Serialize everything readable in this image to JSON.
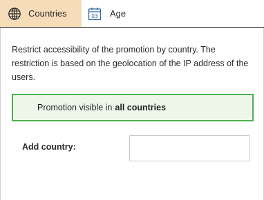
{
  "tabs": {
    "countries": {
      "label": "Countries",
      "icon": "globe-icon",
      "active": true,
      "active_color": "#f6dcb8"
    },
    "age": {
      "label": "Age",
      "icon": "calendar-icon",
      "icon_text": "03",
      "active": false
    }
  },
  "panel": {
    "description": "Restrict accessibility of the promotion by country. The restriction is based on the geolocation of the IP address of the users.",
    "notice": {
      "prefix": "Promotion visible in",
      "emphasis": "all countries",
      "border_color": "#4cb04c",
      "background_color": "#ecf7ea"
    },
    "add_country": {
      "label": "Add country:",
      "value": "",
      "placeholder": ""
    }
  }
}
